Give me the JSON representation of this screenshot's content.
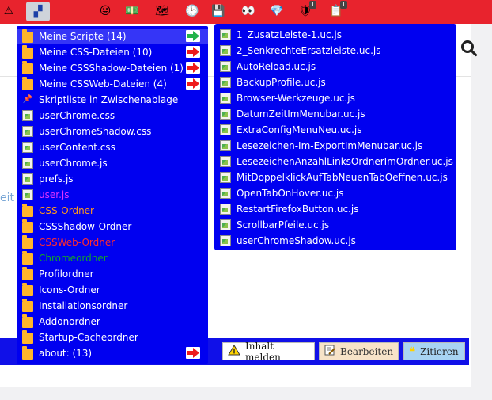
{
  "toolbar": {
    "icons": [
      {
        "name": "warning-icon",
        "glyph": "⚠"
      },
      {
        "name": "script-menu-icon",
        "glyph": "▞"
      },
      {
        "name": "emoji-icon",
        "glyph": "😛"
      },
      {
        "name": "money-icon",
        "glyph": "💵"
      },
      {
        "name": "bookmark-map-icon",
        "glyph": "🗺"
      },
      {
        "name": "clock-icon",
        "glyph": "🕑"
      },
      {
        "name": "save-icon",
        "glyph": "💾"
      },
      {
        "name": "eyes-icon",
        "glyph": "👀"
      },
      {
        "name": "diamond-icon",
        "glyph": "💎"
      },
      {
        "name": "ublock-icon",
        "glyph": "🛡",
        "badge": "1"
      },
      {
        "name": "badge-icon",
        "glyph": "📋",
        "badge": "1"
      }
    ]
  },
  "left_menu": {
    "items": [
      {
        "label": "Meine Scripte (14)",
        "icon": "folder",
        "arrow": "green",
        "highlight": true
      },
      {
        "label": "Meine CSS-Dateien (10)",
        "icon": "folder",
        "arrow": "red"
      },
      {
        "label": "Meine CSSShadow-Dateien (1)",
        "icon": "folder",
        "arrow": "red"
      },
      {
        "label": "Meine CSSWeb-Dateien (4)",
        "icon": "folder",
        "arrow": "red"
      },
      {
        "label": "Skriptliste in Zwischenablage",
        "icon": "pin"
      },
      {
        "label": "userChrome.css",
        "icon": "doc"
      },
      {
        "label": "userChromeShadow.css",
        "icon": "doc"
      },
      {
        "label": "userContent.css",
        "icon": "doc"
      },
      {
        "label": "userChrome.js",
        "icon": "doc"
      },
      {
        "label": "prefs.js",
        "icon": "doc"
      },
      {
        "label": "user.js",
        "icon": "doc",
        "color": "magenta"
      },
      {
        "label": "CSS-Ordner",
        "icon": "folder",
        "color": "orange"
      },
      {
        "label": "CSSShadow-Ordner",
        "icon": "folder"
      },
      {
        "label": "CSSWeb-Ordner",
        "icon": "folder",
        "color": "red"
      },
      {
        "label": "Chromeordner",
        "icon": "folder",
        "color": "green"
      },
      {
        "label": "Profilordner",
        "icon": "folder"
      },
      {
        "label": "Icons-Ordner",
        "icon": "folder"
      },
      {
        "label": "Installationsordner",
        "icon": "folder"
      },
      {
        "label": "Addonordner",
        "icon": "folder"
      },
      {
        "label": "Startup-Cacheordner",
        "icon": "folder"
      },
      {
        "label": "about: (13)",
        "icon": "folder",
        "arrow": "red"
      }
    ]
  },
  "right_menu": {
    "items": [
      "1_ZusatzLeiste-1.uc.js",
      "2_SenkrechteErsatzleiste.uc.js",
      "AutoReload.uc.js",
      "BackupProfile.uc.js",
      "Browser-Werkzeuge.uc.js",
      "DatumZeitImMenubar.uc.js",
      "ExtraConfigMenuNeu.uc.js",
      "Lesezeichen-Im-ExportImMenubar.uc.js",
      "LesezeichenAnzahlLinksOrdnerImOrdner.uc.js",
      "MitDoppelklickAufTabNeuenTabOeffnen.uc.js",
      "OpenTabOnHover.uc.js",
      "RestartFirefoxButton.uc.js",
      "ScrollbarPfeile.uc.js",
      "userChromeShadow.uc.js"
    ]
  },
  "page": {
    "partial_text": "eit"
  },
  "actions": {
    "report": "Inhalt melden",
    "edit": "Bearbeiten",
    "quote": "Zitieren"
  },
  "colors": {
    "toolbar_bg": "#e8232d",
    "menu_bg": "#0000f0",
    "menu_highlight": "#3535f7",
    "text_orange": "#ff9a1a",
    "text_magenta": "#e233ff",
    "text_red": "#ff2c2c",
    "text_green": "#12a825"
  }
}
